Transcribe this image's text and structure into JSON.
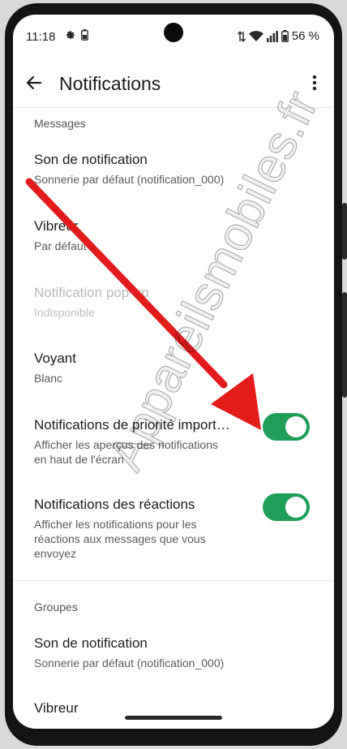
{
  "status_bar": {
    "time": "11:18",
    "battery": "56 %"
  },
  "app_bar": {
    "title": "Notifications"
  },
  "sections": {
    "messages": {
      "header": "Messages",
      "notification_sound": {
        "title": "Son de notification",
        "subtitle": "Sonnerie par défaut (notification_000)"
      },
      "vibrate": {
        "title": "Vibreur",
        "subtitle": "Par défaut"
      },
      "popup": {
        "title": "Notification pop-up",
        "subtitle": "Indisponible"
      },
      "light": {
        "title": "Voyant",
        "subtitle": "Blanc"
      },
      "priority": {
        "title": "Notifications de priorité import…",
        "subtitle_line1": "Afficher les aperçus des notifications",
        "subtitle_line2": "en haut de l'écran",
        "enabled": true
      },
      "reactions": {
        "title": "Notifications des réactions",
        "subtitle_line1": "Afficher les notifications pour les",
        "subtitle_line2": "réactions aux messages que vous",
        "subtitle_line3": "envoyez",
        "enabled": true
      }
    },
    "groups": {
      "header": "Groupes",
      "notification_sound": {
        "title": "Son de notification",
        "subtitle": "Sonnerie par défaut (notification_000)"
      },
      "vibrate_partial": "Vibreur"
    }
  },
  "watermark": "Appareilsmobiles.fr",
  "colors": {
    "toggle_on": "#1e9e57",
    "arrow": "#e31b1b"
  },
  "icons": [
    "settings-gear-icon",
    "battery-icon",
    "wifi-icon",
    "signal-icon",
    "back-arrow-icon",
    "more-vert-icon"
  ]
}
